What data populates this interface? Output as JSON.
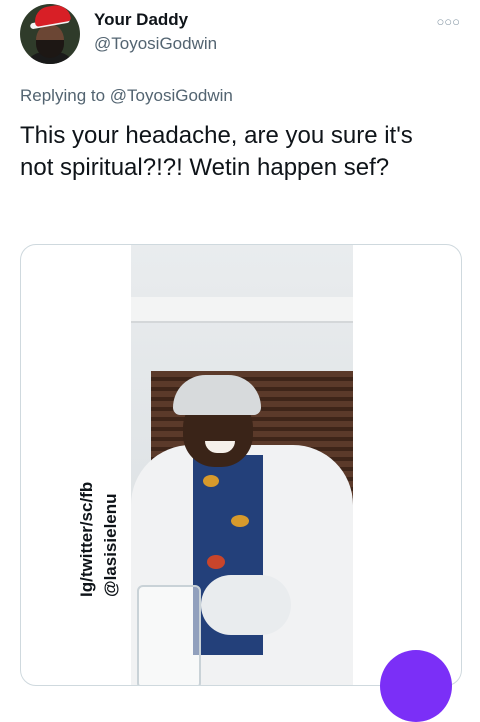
{
  "tweet": {
    "author_name": "Your Daddy",
    "author_handle": "@ToyosiGodwin",
    "more_icon": "more-dots-icon",
    "replying_prefix": "Replying to",
    "replying_handle": "@ToyosiGodwin",
    "text": "This your headache, are you sure it's not spiritual?!?! Wetin happen sef?"
  },
  "media": {
    "watermark_line1": "Ig/twitter/sc/fb",
    "watermark_line2": "@lasisielenu"
  },
  "colors": {
    "secondary_text": "#536471",
    "border": "#cfd9de",
    "accent_purple": "#7b2ff7"
  }
}
